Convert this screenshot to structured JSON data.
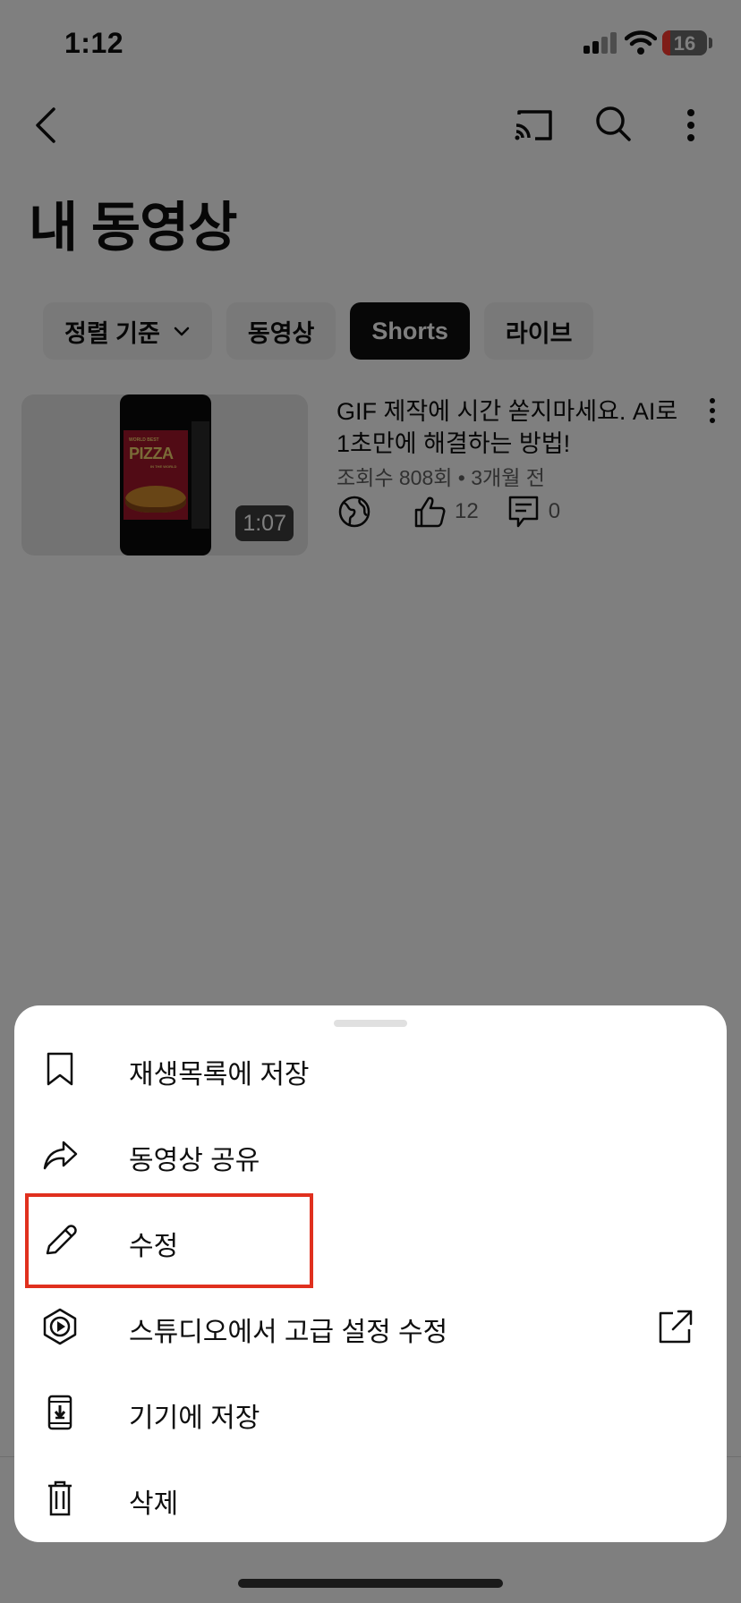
{
  "status_bar": {
    "time": "1:12",
    "battery": "16"
  },
  "header": {
    "title": "내 동영상"
  },
  "chips": [
    {
      "label": "정렬 기준"
    },
    {
      "label": "동영상"
    },
    {
      "label": "Shorts"
    },
    {
      "label": "라이브"
    }
  ],
  "video": {
    "title": "GIF 제작에 시간 쏟지마세요. AI로 1초만에 해결하는 방법!",
    "meta": "조회수 808회 • 3개월 전",
    "likes": "12",
    "comments": "0",
    "duration": "1:07",
    "thumbnail": {
      "text_top": "WORLD BEST",
      "text_main": "PIZZA",
      "text_bottom": "IN THE WORLD"
    }
  },
  "menu": {
    "items": [
      {
        "label": "재생목록에 저장",
        "icon": "bookmark-icon"
      },
      {
        "label": "동영상 공유",
        "icon": "share-icon"
      },
      {
        "label": "수정",
        "icon": "pencil-icon"
      },
      {
        "label": "스튜디오에서 고급 설정 수정",
        "icon": "studio-icon"
      },
      {
        "label": "기기에 저장",
        "icon": "download-icon"
      },
      {
        "label": "삭제",
        "icon": "trash-icon"
      }
    ]
  },
  "colors": {
    "highlight": "#e0301e",
    "battery_low": "#ff3b30",
    "scrim": "rgba(0,0,0,0.5)"
  }
}
